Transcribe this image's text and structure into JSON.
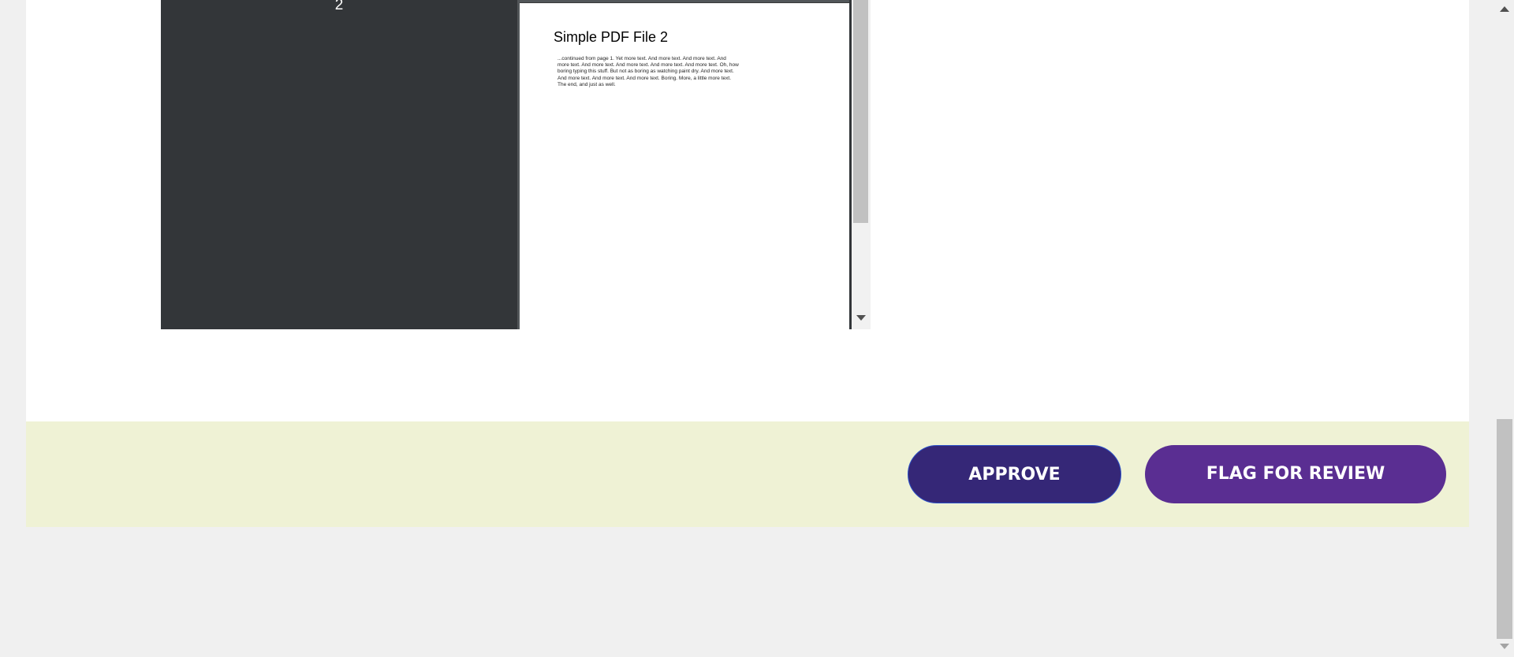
{
  "pdf_viewer": {
    "thumbnail_page_number": "2",
    "page": {
      "title": "Simple PDF File 2",
      "body": "...continued from page 1. Yet more text. And more text. And more text. And more text. And more text. And more text. And more text. And more text. Oh, how boring typing this stuff. But not as boring as watching paint dry. And more text. And more text. And more text. And more text. Boring.  More, a little more text. The end, and just as well."
    }
  },
  "actions": {
    "approve_label": "APPROVE",
    "flag_label": "FLAG FOR REVIEW"
  },
  "colors": {
    "viewer_background": "#333639",
    "approve_button": "#352777",
    "flag_button": "#5a2e92",
    "action_bar": "#eff2d5"
  }
}
